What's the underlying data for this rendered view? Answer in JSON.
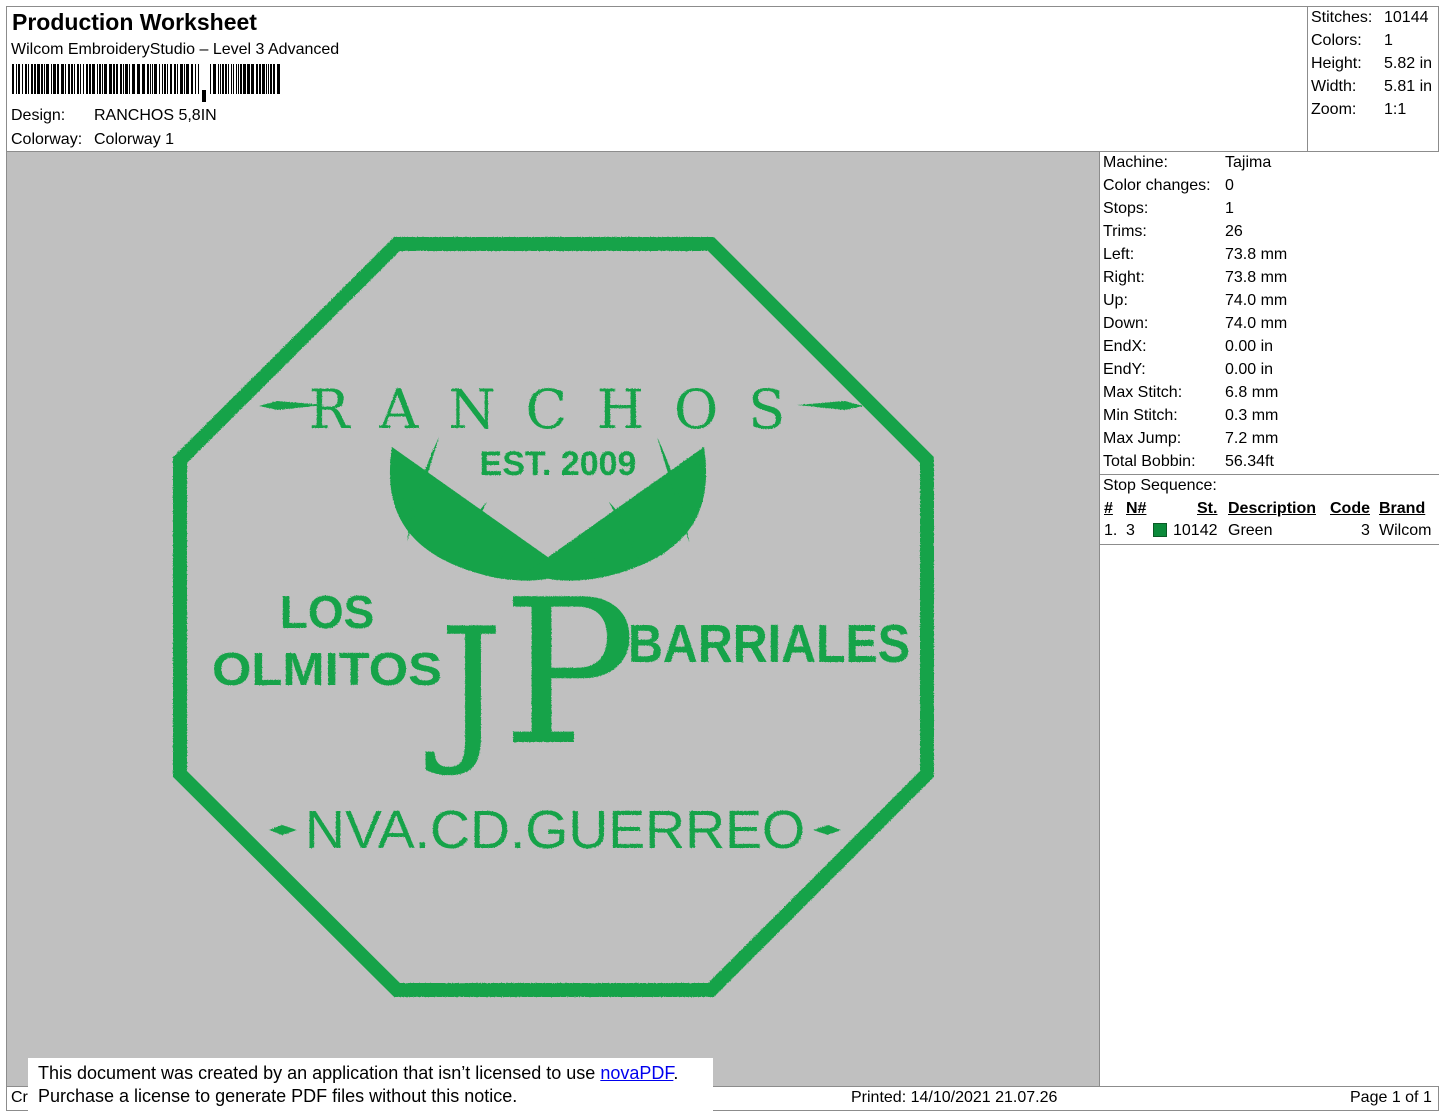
{
  "header": {
    "title": "Production Worksheet",
    "app": "Wilcom EmbroideryStudio – Level 3 Advanced",
    "design_label": "Design:",
    "design_value": "RANCHOS 5,8IN",
    "colorway_label": "Colorway:",
    "colorway_value": "Colorway 1"
  },
  "stats": [
    {
      "label": "Stitches:",
      "value": "10144"
    },
    {
      "label": "Colors:",
      "value": "1"
    },
    {
      "label": "Height:",
      "value": "5.82 in"
    },
    {
      "label": "Width:",
      "value": "5.81 in"
    },
    {
      "label": "Zoom:",
      "value": "1:1"
    }
  ],
  "machine": [
    {
      "label": "Machine:",
      "value": "Tajima"
    },
    {
      "label": "Color changes:",
      "value": "0"
    },
    {
      "label": "Stops:",
      "value": "1"
    },
    {
      "label": "Trims:",
      "value": "26"
    },
    {
      "label": "Left:",
      "value": "73.8 mm"
    },
    {
      "label": "Right:",
      "value": "73.8 mm"
    },
    {
      "label": "Up:",
      "value": "74.0 mm"
    },
    {
      "label": "Down:",
      "value": "74.0 mm"
    },
    {
      "label": "EndX:",
      "value": "0.00 in"
    },
    {
      "label": "EndY:",
      "value": "0.00 in"
    },
    {
      "label": "Max Stitch:",
      "value": "6.8 mm"
    },
    {
      "label": "Min Stitch:",
      "value": "0.3 mm"
    },
    {
      "label": "Max Jump:",
      "value": "7.2 mm"
    },
    {
      "label": "Total Bobbin:",
      "value": "56.34ft"
    }
  ],
  "stop_sequence": {
    "title": "Stop Sequence:",
    "headers": {
      "num": "#",
      "needle": "N#",
      "st": "St.",
      "description": "Description",
      "code": "Code",
      "brand": "Brand"
    },
    "rows": [
      {
        "num": "1.",
        "needle": "3",
        "color": "#0b8a3a",
        "st": "10142",
        "description": "Green",
        "code": "3",
        "brand": "Wilcom"
      }
    ]
  },
  "design": {
    "thread_color": "#16a34a",
    "background_color": "#c0c0c0",
    "top_text": "RANCHOS",
    "est_text": "EST. 2009",
    "left_line1": "LOS",
    "left_line2": "OLMITOS",
    "right_text": "BARRIALES",
    "monogram_j": "J",
    "monogram_p": "P",
    "bottom_text": "NVA.CD.GUERREO"
  },
  "footer": {
    "created": "Cr",
    "printed": "Printed: 14/10/2021 21.07.26",
    "page": "Page 1 of 1"
  },
  "notice": {
    "line1_pre": "This document was created by an application that isn’t licensed to use ",
    "link": "novaPDF",
    "line1_post": ".",
    "line2": "Purchase a license to generate PDF files without this notice."
  }
}
